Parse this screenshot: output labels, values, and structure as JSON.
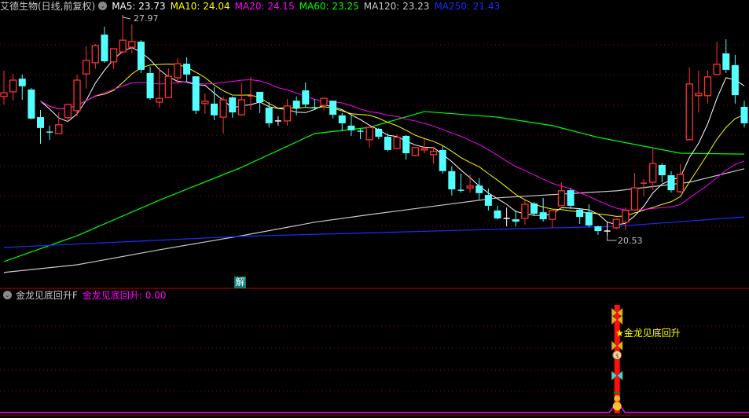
{
  "header": {
    "title": "艾德生物(日线,前复权)",
    "ma": [
      {
        "label": "MA5: 23.73",
        "color": "#ffffff"
      },
      {
        "label": "MA10: 24.04",
        "color": "#ffff00"
      },
      {
        "label": "MA20: 24.15",
        "color": "#ff00ff"
      },
      {
        "label": "MA60: 23.25",
        "color": "#00ff00"
      },
      {
        "label": "MA120: 23.23",
        "color": "#c8c8c8"
      },
      {
        "label": "MA250: 21.43",
        "color": "#1a2cff"
      }
    ]
  },
  "annotations": {
    "high": "27.97",
    "low": "20.53",
    "jie": "解"
  },
  "indicator": {
    "name": "金龙见底回升F",
    "value_label": "金龙见底回升: 0.00",
    "signal_text": "金龙见底回升",
    "signal_icon": "star-icon"
  },
  "colors": {
    "up": "#ff3232",
    "down": "#54ffff",
    "grid": "#8a0000",
    "doji": "#ffffff"
  },
  "chart_data": {
    "type": "candlestick",
    "title": "艾德生物(日线,前复权)",
    "high_marker": 27.97,
    "low_marker": 20.53,
    "candles_ohlc": [
      [
        25.27,
        26.15,
        25.0,
        25.4
      ],
      [
        25.43,
        26.04,
        25.13,
        25.83
      ],
      [
        25.88,
        26.02,
        25.16,
        25.62
      ],
      [
        25.51,
        25.56,
        24.49,
        24.52
      ],
      [
        24.57,
        24.81,
        23.66,
        24.2
      ],
      [
        24.06,
        24.28,
        23.8,
        24.06
      ],
      [
        24.01,
        24.73,
        24.01,
        24.31
      ],
      [
        24.55,
        25.03,
        24.39,
        25.0
      ],
      [
        24.79,
        26.02,
        24.6,
        25.83
      ],
      [
        26.04,
        26.98,
        25.54,
        26.5
      ],
      [
        26.42,
        27.06,
        26.21,
        27.01
      ],
      [
        27.38,
        27.65,
        26.42,
        26.47
      ],
      [
        26.45,
        26.9,
        26.21,
        26.9
      ],
      [
        26.79,
        27.97,
        26.74,
        27.19
      ],
      [
        26.95,
        27.73,
        26.74,
        27.14
      ],
      [
        27.14,
        27.19,
        26.07,
        26.18
      ],
      [
        26.07,
        26.29,
        25.16,
        25.21
      ],
      [
        25.08,
        26.26,
        24.89,
        25.21
      ],
      [
        25.24,
        26.23,
        25.24,
        25.96
      ],
      [
        25.91,
        26.58,
        25.7,
        26.39
      ],
      [
        26.39,
        26.61,
        25.78,
        26.02
      ],
      [
        25.96,
        25.96,
        24.68,
        24.79
      ],
      [
        25.03,
        25.38,
        24.68,
        25.11
      ],
      [
        25.03,
        25.59,
        24.47,
        24.63
      ],
      [
        24.57,
        25.27,
        24.01,
        25.16
      ],
      [
        25.24,
        25.27,
        24.55,
        24.73
      ],
      [
        24.65,
        25.72,
        24.63,
        25.16
      ],
      [
        25.27,
        25.94,
        24.81,
        25.29
      ],
      [
        25.43,
        25.43,
        24.71,
        25.08
      ],
      [
        24.89,
        25.08,
        24.22,
        24.36
      ],
      [
        24.44,
        24.6,
        24.28,
        24.44
      ],
      [
        24.44,
        25.19,
        24.28,
        24.95
      ],
      [
        25.13,
        25.27,
        24.63,
        24.87
      ],
      [
        25.48,
        25.75,
        24.92,
        25.0
      ],
      [
        24.89,
        25.19,
        24.81,
        24.89
      ],
      [
        24.97,
        25.21,
        24.79,
        25.21
      ],
      [
        25.13,
        25.13,
        24.52,
        24.65
      ],
      [
        24.63,
        24.71,
        24.09,
        24.36
      ],
      [
        24.28,
        24.63,
        23.93,
        24.12
      ],
      [
        24.09,
        24.17,
        23.82,
        24.09
      ],
      [
        23.8,
        24.25,
        23.53,
        24.22
      ],
      [
        24.17,
        24.2,
        23.82,
        23.9
      ],
      [
        23.9,
        24.01,
        23.4,
        23.45
      ],
      [
        23.5,
        23.98,
        23.47,
        23.88
      ],
      [
        23.93,
        23.96,
        23.13,
        23.34
      ],
      [
        23.26,
        23.56,
        23.23,
        23.53
      ],
      [
        23.45,
        23.82,
        23.34,
        23.5
      ],
      [
        23.29,
        23.56,
        22.99,
        23.4
      ],
      [
        23.45,
        23.58,
        22.65,
        22.73
      ],
      [
        22.73,
        22.89,
        21.9,
        22.11
      ],
      [
        22.08,
        22.65,
        22.0,
        22.08
      ],
      [
        22.16,
        22.62,
        22.0,
        22.22
      ],
      [
        22.24,
        22.49,
        21.76,
        21.98
      ],
      [
        21.92,
        22.14,
        21.39,
        21.55
      ],
      [
        21.39,
        21.55,
        21.09,
        21.12
      ],
      [
        21.12,
        21.49,
        20.85,
        21.12
      ],
      [
        21.09,
        21.39,
        20.85,
        21.01
      ],
      [
        21.12,
        21.74,
        20.91,
        21.6
      ],
      [
        21.63,
        21.68,
        21.2,
        21.28
      ],
      [
        21.33,
        21.82,
        21.01,
        21.09
      ],
      [
        21.09,
        21.41,
        20.8,
        21.39
      ],
      [
        21.55,
        22.35,
        21.55,
        22.06
      ],
      [
        22.08,
        22.16,
        21.44,
        21.55
      ],
      [
        21.42,
        21.44,
        20.93,
        21.17
      ],
      [
        21.33,
        21.6,
        20.83,
        20.88
      ],
      [
        20.85,
        20.88,
        20.56,
        20.69
      ],
      [
        20.69,
        20.99,
        20.53,
        20.69
      ],
      [
        20.8,
        21.12,
        20.75,
        21.09
      ],
      [
        20.99,
        21.49,
        20.72,
        21.39
      ],
      [
        21.41,
        22.67,
        21.39,
        22.16
      ],
      [
        22.3,
        22.46,
        21.87,
        22.32
      ],
      [
        22.35,
        23.5,
        22.08,
        22.99
      ],
      [
        22.94,
        23.0,
        22.35,
        22.59
      ],
      [
        22.59,
        22.73,
        22.0,
        22.08
      ],
      [
        22.03,
        22.97,
        21.98,
        22.62
      ],
      [
        23.8,
        26.26,
        23.78,
        25.7
      ],
      [
        25.3,
        26.15,
        24.73,
        25.38
      ],
      [
        25.3,
        26.15,
        25.03,
        25.94
      ],
      [
        26.02,
        27.14,
        26.02,
        26.37
      ],
      [
        26.74,
        27.22,
        26.07,
        26.18
      ],
      [
        26.34,
        26.69,
        25.03,
        25.32
      ],
      [
        24.92,
        25.13,
        24.22,
        24.36
      ]
    ],
    "ma_long": {
      "MA60": [
        [
          0,
          19.65
        ],
        [
          8,
          20.53
        ],
        [
          17,
          21.74
        ],
        [
          26,
          22.86
        ],
        [
          34,
          24.01
        ],
        [
          40,
          24.22
        ],
        [
          46,
          24.76
        ],
        [
          54,
          24.57
        ],
        [
          60,
          24.28
        ],
        [
          65,
          23.88
        ],
        [
          74,
          23.34
        ],
        [
          81,
          23.31
        ]
      ],
      "MA120": [
        [
          0,
          19.28
        ],
        [
          8,
          19.54
        ],
        [
          17,
          20.05
        ],
        [
          26,
          20.53
        ],
        [
          34,
          20.99
        ],
        [
          40,
          21.25
        ],
        [
          54,
          21.82
        ],
        [
          67,
          22.06
        ],
        [
          75,
          22.35
        ],
        [
          81,
          22.81
        ]
      ],
      "MA250": [
        [
          0,
          20.13
        ],
        [
          26,
          20.51
        ],
        [
          54,
          20.75
        ],
        [
          67,
          20.85
        ],
        [
          81,
          21.17
        ]
      ]
    },
    "ma_short_periods": {
      "MA5": 5,
      "MA10": 10,
      "MA20": 20
    },
    "signal_index": 67,
    "indicator_value": 0.0
  }
}
